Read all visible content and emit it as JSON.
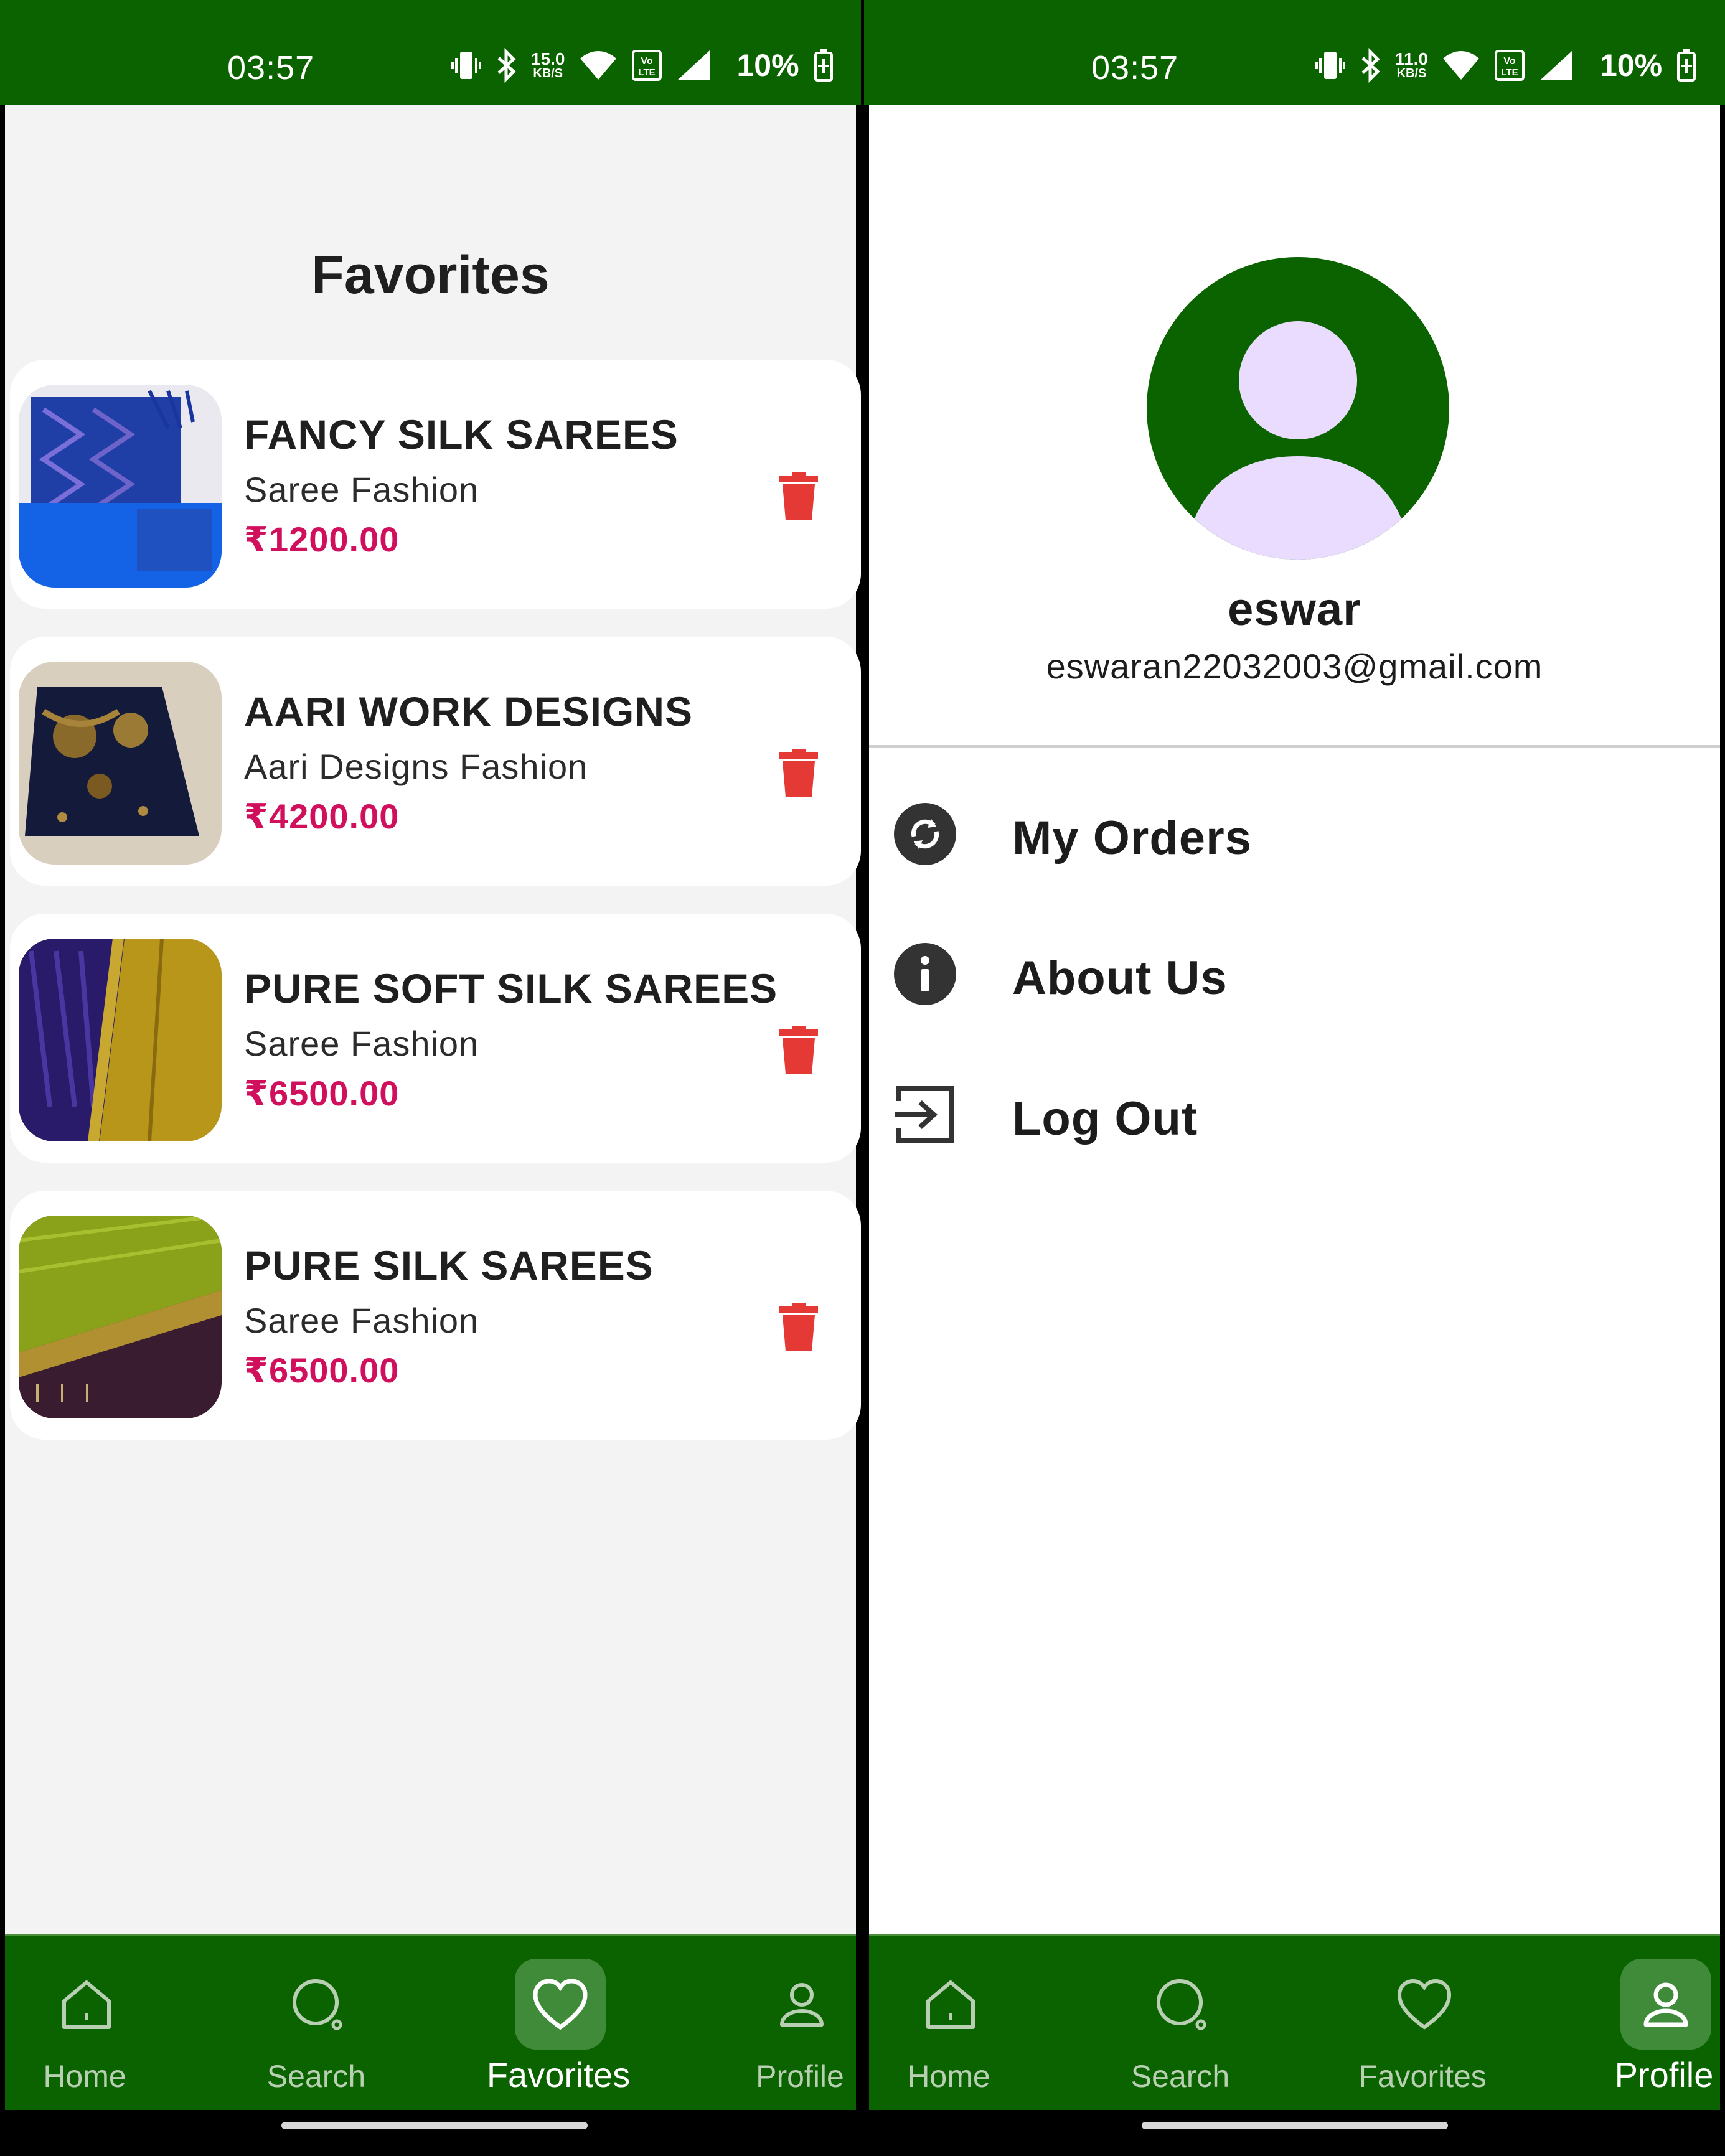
{
  "colors": {
    "brand_green": "#0b6300",
    "price": "#d0105c",
    "delete": "#e53935",
    "avatar_figure": "#eadcff"
  },
  "status_bar": {
    "time": "03:57",
    "battery": "10%",
    "speed_left": "15.0",
    "speed_right": "11.0",
    "speed_unit": "KB/S"
  },
  "favorites": {
    "title": "Favorites",
    "items": [
      {
        "name": "FANCY SILK SAREES",
        "category": "Saree Fashion",
        "price": "₹1200.00"
      },
      {
        "name": "AARI WORK DESIGNS",
        "category": "Aari Designs Fashion",
        "price": "₹4200.00"
      },
      {
        "name": "PURE SOFT SILK SAREES",
        "category": "Saree Fashion",
        "price": "₹6500.00"
      },
      {
        "name": "PURE SILK SAREES",
        "category": "Saree Fashion",
        "price": "₹6500.00"
      }
    ]
  },
  "profile": {
    "name": "eswar",
    "email": "eswaran22032003@gmail.com",
    "menu": [
      {
        "label": "My Orders",
        "icon": "sync-circle-icon"
      },
      {
        "label": "About Us",
        "icon": "info-circle-icon"
      },
      {
        "label": "Log Out",
        "icon": "logout-icon"
      }
    ]
  },
  "nav": {
    "home": "Home",
    "search": "Search",
    "favorites": "Favorites",
    "profile": "Profile"
  }
}
